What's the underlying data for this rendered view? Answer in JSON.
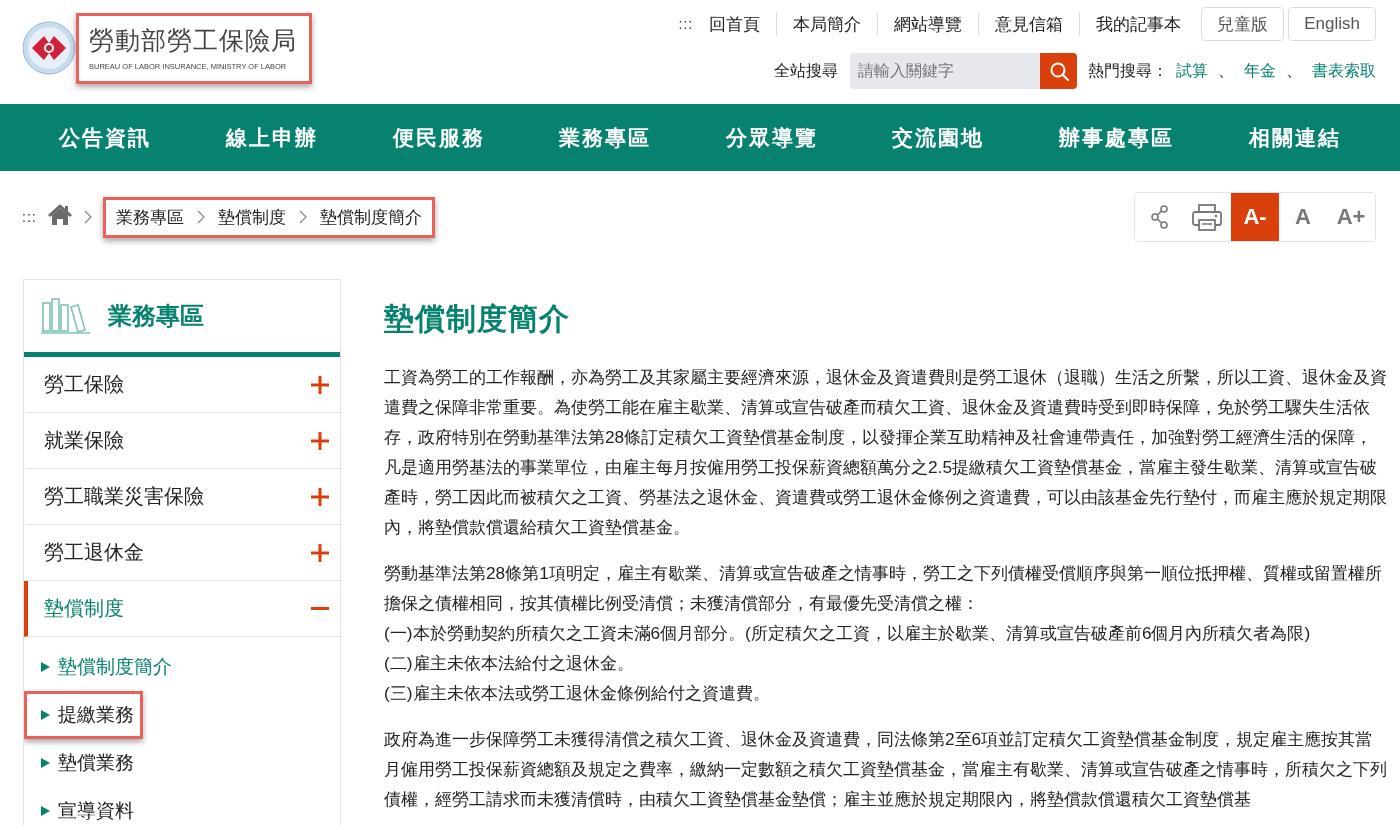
{
  "header": {
    "logo": {
      "title": "勞動部勞工保險局",
      "subtitle": "BUREAU OF LABOR INSURANCE, MINISTRY OF LABOR",
      "highlighted": true
    },
    "accesskey": ":::",
    "top_links": [
      "回首頁",
      "本局簡介",
      "網站導覽",
      "意見信箱",
      "我的記事本"
    ],
    "lang_buttons": [
      "兒童版",
      "English"
    ],
    "search": {
      "label": "全站搜尋",
      "placeholder": "請輸入關鍵字"
    },
    "hot_search": {
      "label": "熱門搜尋：",
      "links": [
        "試算",
        "年金",
        "書表索取"
      ],
      "separator": "、"
    }
  },
  "main_nav": [
    "公告資訊",
    "線上申辦",
    "便民服務",
    "業務專區",
    "分眾導覽",
    "交流園地",
    "辦事處專區",
    "相關連結"
  ],
  "breadcrumb": {
    "accesskey": ":::",
    "items": [
      "業務專區",
      "墊償制度",
      "墊償制度簡介"
    ],
    "highlighted": true
  },
  "tools": [
    {
      "kind": "share"
    },
    {
      "kind": "print"
    },
    {
      "kind": "font",
      "label": "A-",
      "selected": true
    },
    {
      "kind": "font",
      "label": "A",
      "selected": false
    },
    {
      "kind": "font",
      "label": "A+",
      "selected": false
    }
  ],
  "sidebar": {
    "title": "業務專區",
    "items": [
      {
        "label": "勞工保險",
        "expanded": false,
        "selected": false
      },
      {
        "label": "就業保險",
        "expanded": false,
        "selected": false
      },
      {
        "label": "勞工職業災害保險",
        "expanded": false,
        "selected": false
      },
      {
        "label": "勞工退休金",
        "expanded": false,
        "selected": false
      },
      {
        "label": "墊償制度",
        "expanded": true,
        "selected": true,
        "children": [
          {
            "label": "墊償制度簡介",
            "highlighted": false,
            "selected": true
          },
          {
            "label": "提繳業務",
            "highlighted": true,
            "selected": false
          },
          {
            "label": "墊償業務",
            "highlighted": false,
            "selected": false
          },
          {
            "label": "宣導資料",
            "highlighted": false,
            "selected": false
          }
        ]
      }
    ]
  },
  "content": {
    "title": "墊償制度簡介",
    "paragraphs": [
      {
        "lines": [
          "工資為勞工的工作報酬，亦為勞工及其家屬主要經濟來源，退休金及資遣費則是勞工退休（退職）生活之所繫，所以工資、退休金及資遣費之保障非常重要。為使勞工能在雇主歇業、清算或宣告破產而積欠工資、退休金及資遣費時受到即時保障，免於勞工驟失生活依存，政府特別在勞動基準法第28條訂定積欠工資墊償基金制度，以發揮企業互助精神及社會連帶責任，加強對勞工經濟生活的保障，凡是適用勞基法的事業單位，由雇主每月按僱用勞工投保薪資總額萬分之2.5提繳積欠工資墊償基金，當雇主發生歇業、清算或宣告破產時，勞工因此而被積欠之工資、勞基法之退休金、資遣費或勞工退休金條例之資遣費，可以由該基金先行墊付，而雇主應於規定期限內，將墊償款償還給積欠工資墊償基金。"
        ]
      },
      {
        "lines": [
          "勞動基準法第28條第1項明定，雇主有歇業、清算或宣告破產之情事時，勞工之下列債權受償順序與第一順位抵押權、質權或留置權所擔保之債權相同，按其債權比例受清償；未獲清償部分，有最優先受清償之權：",
          "(一)本於勞動契約所積欠之工資未滿6個月部分。(所定積欠之工資，以雇主於歇業、清算或宣告破產前6個月內所積欠者為限)",
          "(二)雇主未依本法給付之退休金。",
          "(三)雇主未依本法或勞工退休金條例給付之資遣費。"
        ]
      },
      {
        "lines": [
          "政府為進一步保障勞工未獲得清償之積欠工資、退休金及資遣費，同法條第2至6項並訂定積欠工資墊償基金制度，規定雇主應按其當月僱用勞工投保薪資總額及規定之費率，繳納一定數額之積欠工資墊償基金，當雇主有歇業、清算或宣告破產之情事時，所積欠之下列債權，經勞工請求而未獲清償時，由積欠工資墊償基金墊償；雇主並應於規定期限內，將墊償款償還積欠工資墊償基"
        ]
      }
    ]
  }
}
